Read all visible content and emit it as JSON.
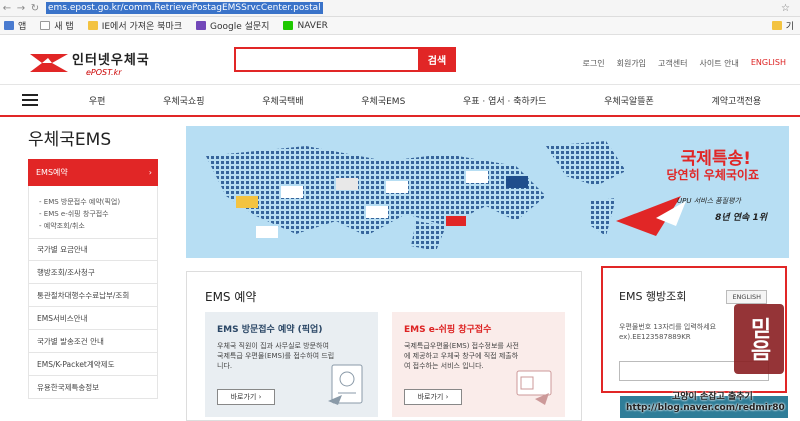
{
  "browser": {
    "url": "ems.epost.go.kr/comm.RetrievePostagEMSSrvcCenter.postal",
    "bookmarks": [
      "앱",
      "새 탭",
      "IE에서 가져온 북마크",
      "Google 설문지",
      "NAVER"
    ],
    "more_label": "기"
  },
  "header": {
    "logo_main": "인터넷우체국",
    "logo_sub": "ePOST.kr",
    "search_button": "검색",
    "search_value": "",
    "top_links": [
      "로그인",
      "회원가입",
      "고객센터",
      "사이트 안내",
      "ENGLISH"
    ]
  },
  "gnb": {
    "items": [
      "우편",
      "우체국쇼핑",
      "우체국택배",
      "우체국EMS",
      "우표 · 엽서 · 축하카드",
      "우체국알뜰폰",
      "계약고객전용"
    ]
  },
  "sidebar": {
    "title": "우체국EMS",
    "active": "EMS예약",
    "active_arrow": "›",
    "subitems": [
      "EMS 방문접수 예약(픽업)",
      "EMS e-쉬핑 창구접수",
      "예약조회/취소"
    ],
    "items": [
      "국가별 요금안내",
      "행방조회/조사청구",
      "통관절차대행수수료납부/조회",
      "EMS서비스안내",
      "국가별 발송조건 안내",
      "EMS/K-Packet계약제도",
      "유용한국제특송정보"
    ]
  },
  "banner": {
    "title": "국제특송!",
    "subtitle": "당연히 우체국이죠",
    "note1": "UPU 서비스 품질평가",
    "note2": "8년 연속 1위"
  },
  "ems_reserve": {
    "title": "EMS 예약",
    "cards": [
      {
        "title": "EMS 방문접수 예약 (픽업)",
        "desc": "우체국 직원이 집과 사무실로 방문하여 국제특급 우편물(EMS)를 접수하여 드립니다.",
        "button": "바로가기 ›"
      },
      {
        "title": "EMS e-쉬핑 창구접수",
        "desc": "국제특급우편물(EMS) 접수정보를 사전에 제공하고 우체국 창구에 직접 제출하여 접수하는 서비스 입니다.",
        "button": "바로가기 ›"
      }
    ]
  },
  "tracking": {
    "title": "EMS 행방조회",
    "english_button": "ENGLISH",
    "help_line1": "우편물번호 13자리를 입력하세요",
    "help_line2": "ex).EE123587889KR",
    "input_value": ""
  },
  "overlay": {
    "stamp": "믿음",
    "watermark1": "고양이 손잡고 출추기",
    "watermark2": "http://blog.naver.com/redmir80"
  },
  "colors": {
    "accent": "#e12626",
    "navy": "#2b4766",
    "teal": "#2f7d98"
  }
}
